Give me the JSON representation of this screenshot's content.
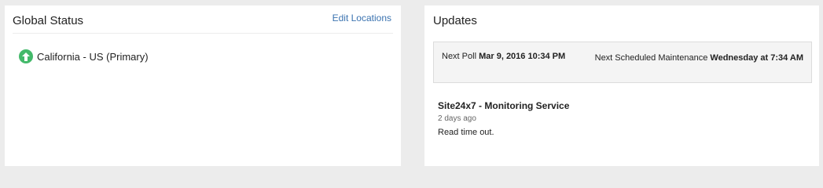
{
  "global_status": {
    "title": "Global Status",
    "edit_link": "Edit Locations",
    "locations": [
      {
        "name": "California - US (Primary)",
        "status": "up",
        "status_icon": "arrow-up-icon"
      }
    ]
  },
  "updates": {
    "title": "Updates",
    "next_poll_label": "Next Poll",
    "next_poll_value": "Mar 9, 2016 10:34 PM",
    "next_maintenance_label": "Next Scheduled Maintenance",
    "next_maintenance_value": "Wednesday at 7:34 AM",
    "items": [
      {
        "title": "Site24x7 - Monitoring Service",
        "time": "2 days ago",
        "message": "Read time out."
      }
    ]
  },
  "colors": {
    "up_status": "#43b96a",
    "link": "#3b73b0",
    "background": "#ececec"
  }
}
